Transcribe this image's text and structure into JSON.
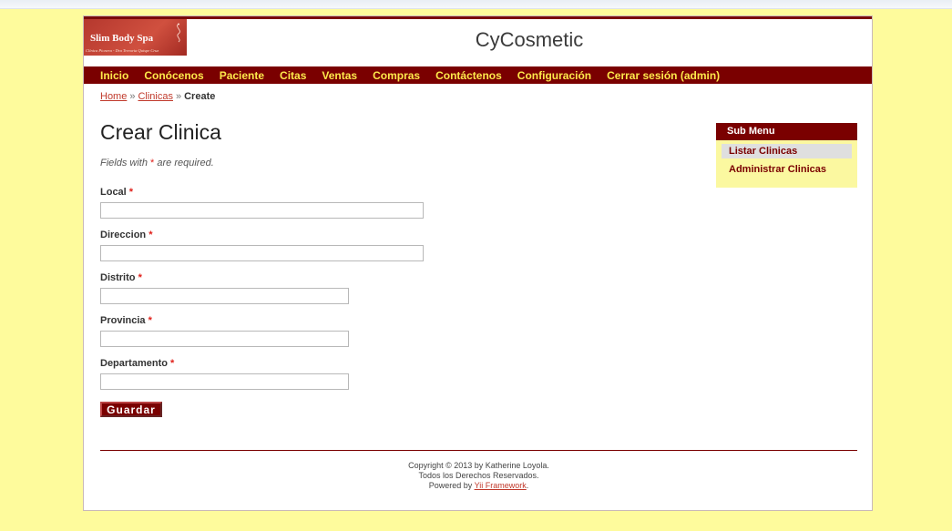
{
  "logo": {
    "title": "Slim Body Spa",
    "tagline": "Clínica Pionera - Dra Trevoria Quispe Cruz"
  },
  "site_title": "CyCosmetic",
  "mainmenu": [
    {
      "label": "Inicio"
    },
    {
      "label": "Conócenos"
    },
    {
      "label": "Paciente"
    },
    {
      "label": "Citas"
    },
    {
      "label": "Ventas"
    },
    {
      "label": "Compras"
    },
    {
      "label": "Contáctenos"
    },
    {
      "label": "Configuración"
    },
    {
      "label": "Cerrar sesión (admin)"
    }
  ],
  "breadcrumbs": {
    "home": "Home",
    "separator": "»",
    "clinicas": "Clinicas",
    "current": "Create"
  },
  "page_title": "Crear Clinica",
  "note": {
    "prefix": "Fields with",
    "required_mark": "*",
    "suffix": "are required."
  },
  "form": {
    "required_mark": "*",
    "fields": [
      {
        "label": "Local",
        "value": ""
      },
      {
        "label": "Direccion",
        "value": ""
      },
      {
        "label": "Distrito",
        "value": ""
      },
      {
        "label": "Provincia",
        "value": ""
      },
      {
        "label": "Departamento",
        "value": ""
      }
    ],
    "submit_label": "Guardar"
  },
  "sidebar": {
    "title": "Sub Menu",
    "items": [
      {
        "label": "Listar Clinicas"
      },
      {
        "label": "Administrar Clinicas"
      }
    ]
  },
  "footer": {
    "copyright": "Copyright © 2013 by Katherine Loyola.",
    "rights": "Todos los Derechos Reservados.",
    "powered_prefix": "Powered by",
    "powered_link": "Yii Framework",
    "powered_suffix": "."
  },
  "colors": {
    "background": "#fefb9c",
    "brand": "#7a0000",
    "menu_text": "#fee94b",
    "link": "#c0392b"
  }
}
